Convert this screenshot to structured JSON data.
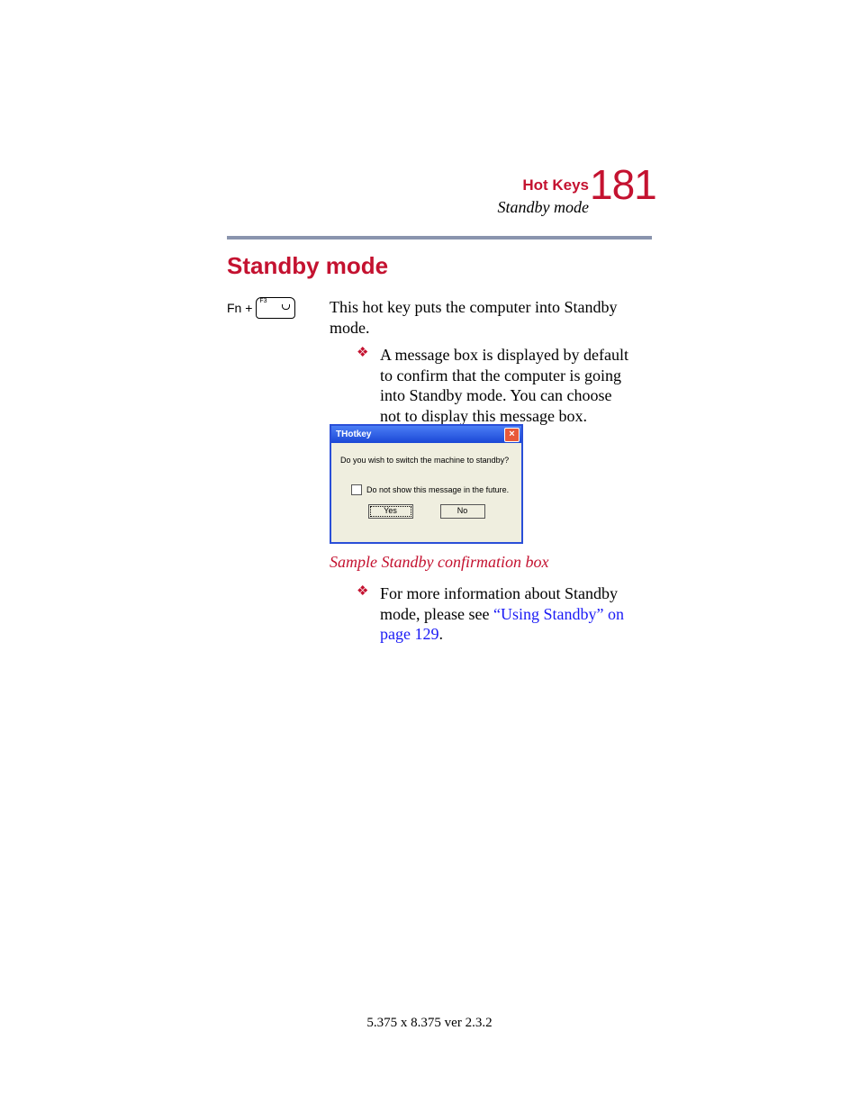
{
  "header": {
    "chapter": "Hot Keys",
    "section_sub": "Standby mode",
    "page_number": "181"
  },
  "title": "Standby mode",
  "hotkey": {
    "fn_label": "Fn +",
    "key_label": "F3"
  },
  "intro": "This hot key puts the computer into Standby mode.",
  "bullet1": "A message box is displayed by default to confirm that the computer is going into Standby mode. You can choose not to display this message box.",
  "dialog": {
    "title": "THotkey",
    "message": "Do you wish to switch the machine to standby?",
    "checkbox_label": "Do not show this message in the future.",
    "yes": "Yes",
    "no": "No"
  },
  "caption": "Sample Standby confirmation box",
  "bullet2": {
    "pre": "For more information about Standby mode, please see ",
    "link": "“Using Standby” on page 129",
    "post": "."
  },
  "footer": "5.375 x 8.375 ver 2.3.2"
}
